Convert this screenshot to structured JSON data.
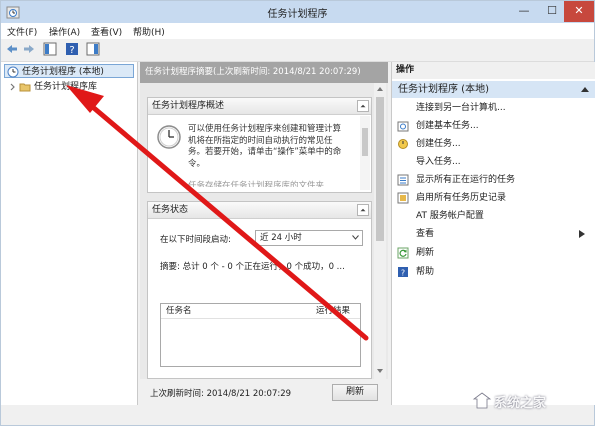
{
  "window": {
    "title": "任务计划程序",
    "min": "—",
    "max": "☐",
    "close": "✕"
  },
  "menu": [
    "文件(F)",
    "操作(A)",
    "查看(V)",
    "帮助(H)"
  ],
  "tree": {
    "root": "任务计划程序 (本地)",
    "library": "任务计划程序库"
  },
  "center": {
    "header": "任务计划程序摘要(上次刷新时间: 2014/8/21 20:07:29)",
    "overview": {
      "title": "任务计划程序概述",
      "text": "可以使用任务计划程序来创建和管理计算机将在所指定的时间自动执行的常见任务。若要开始，请单击“操作”菜单中的命令。",
      "text_cut": "任务存储在任务计划程序库的文件夹"
    },
    "status": {
      "title": "任务状态",
      "period_label": "在以下时间段启动:",
      "period_value": "近 24 小时",
      "summary": "摘要: 总计 0 个 - 0 个正在运行，0 个成功，0 ...",
      "col_name": "任务名",
      "col_result": "运行结果"
    },
    "footer": {
      "last_refresh": "上次刷新时间: 2014/8/21 20:07:29",
      "refresh_button": "刷新"
    }
  },
  "actions": {
    "header": "操作",
    "group": "任务计划程序 (本地)",
    "items": [
      {
        "label": "连接到另一台计算机...",
        "icon": "none"
      },
      {
        "label": "创建基本任务...",
        "icon": "basic-task-icon"
      },
      {
        "label": "创建任务...",
        "icon": "create-task-icon"
      },
      {
        "label": "导入任务...",
        "icon": "none"
      },
      {
        "label": "显示所有正在运行的任务",
        "icon": "running-tasks-icon"
      },
      {
        "label": "启用所有任务历史记录",
        "icon": "history-icon"
      },
      {
        "label": "AT 服务帐户配置",
        "icon": "none"
      },
      {
        "label": "查看",
        "icon": "none"
      },
      {
        "label": "刷新",
        "icon": "refresh-icon"
      },
      {
        "label": "帮助",
        "icon": "help-icon"
      }
    ]
  },
  "watermark": {
    "text": "系统之家"
  },
  "colors": {
    "selection": "#dbe9f7",
    "group_header": "#d6e5f5",
    "arrow": "#e01818",
    "close_button": "#c7483d"
  }
}
